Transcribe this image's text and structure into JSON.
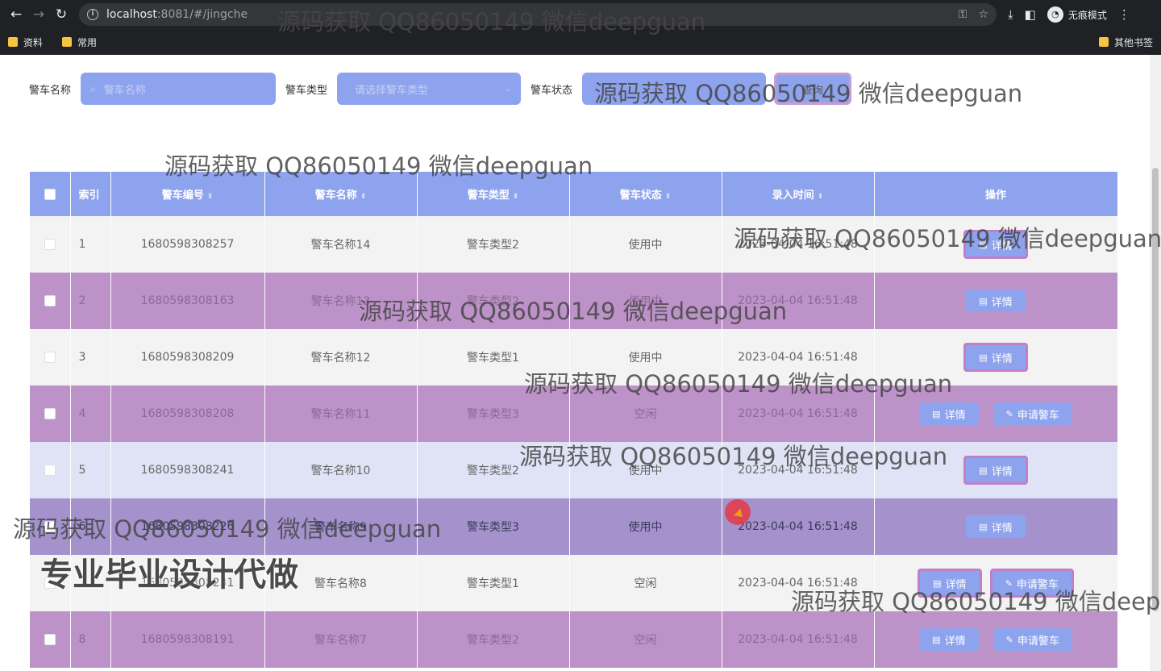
{
  "browser": {
    "url_host": "localhost",
    "url_rest": ":8081/#/jingche",
    "incognito_label": "无痕模式",
    "bookmarks": [
      "资料",
      "常用"
    ],
    "other_bookmarks": "其他书签"
  },
  "search": {
    "name_label": "警车名称",
    "name_placeholder": "警车名称",
    "type_label": "警车类型",
    "type_placeholder": "请选择警车类型",
    "status_label": "警车状态",
    "query_label": "查询"
  },
  "table": {
    "headers": [
      "索引",
      "警车编号",
      "警车名称",
      "警车类型",
      "警车状态",
      "录入时间",
      "操作"
    ],
    "detail_label": "详情",
    "apply_label": "申请警车",
    "rows": [
      {
        "index": "1",
        "code": "1680598308257",
        "name": "警车名称14",
        "type": "警车类型2",
        "status": "使用中",
        "time": "2023-04-04 16:51:48"
      },
      {
        "index": "2",
        "code": "1680598308163",
        "name": "警车名称13",
        "type": "警车类型2",
        "status": "使用中",
        "time": "2023-04-04 16:51:48"
      },
      {
        "index": "3",
        "code": "1680598308209",
        "name": "警车名称12",
        "type": "警车类型1",
        "status": "使用中",
        "time": "2023-04-04 16:51:48"
      },
      {
        "index": "4",
        "code": "1680598308208",
        "name": "警车名称11",
        "type": "警车类型3",
        "status": "空闲",
        "time": "2023-04-04 16:51:48"
      },
      {
        "index": "5",
        "code": "1680598308241",
        "name": "警车名称10",
        "type": "警车类型2",
        "status": "使用中",
        "time": "2023-04-04 16:51:48"
      },
      {
        "index": "6",
        "code": "1680598308226",
        "name": "警车名称9",
        "type": "警车类型3",
        "status": "使用中",
        "time": "2023-04-04 16:51:48"
      },
      {
        "index": "7",
        "code": "1680598308231",
        "name": "警车名称8",
        "type": "警车类型1",
        "status": "空闲",
        "time": "2023-04-04 16:51:48"
      },
      {
        "index": "8",
        "code": "1680598308191",
        "name": "警车名称7",
        "type": "警车类型2",
        "status": "空闲",
        "time": "2023-04-04 16:51:48"
      }
    ]
  },
  "watermark": "源码获取 QQ86050149 微信deepguan",
  "promo": "专业毕业设计代做"
}
